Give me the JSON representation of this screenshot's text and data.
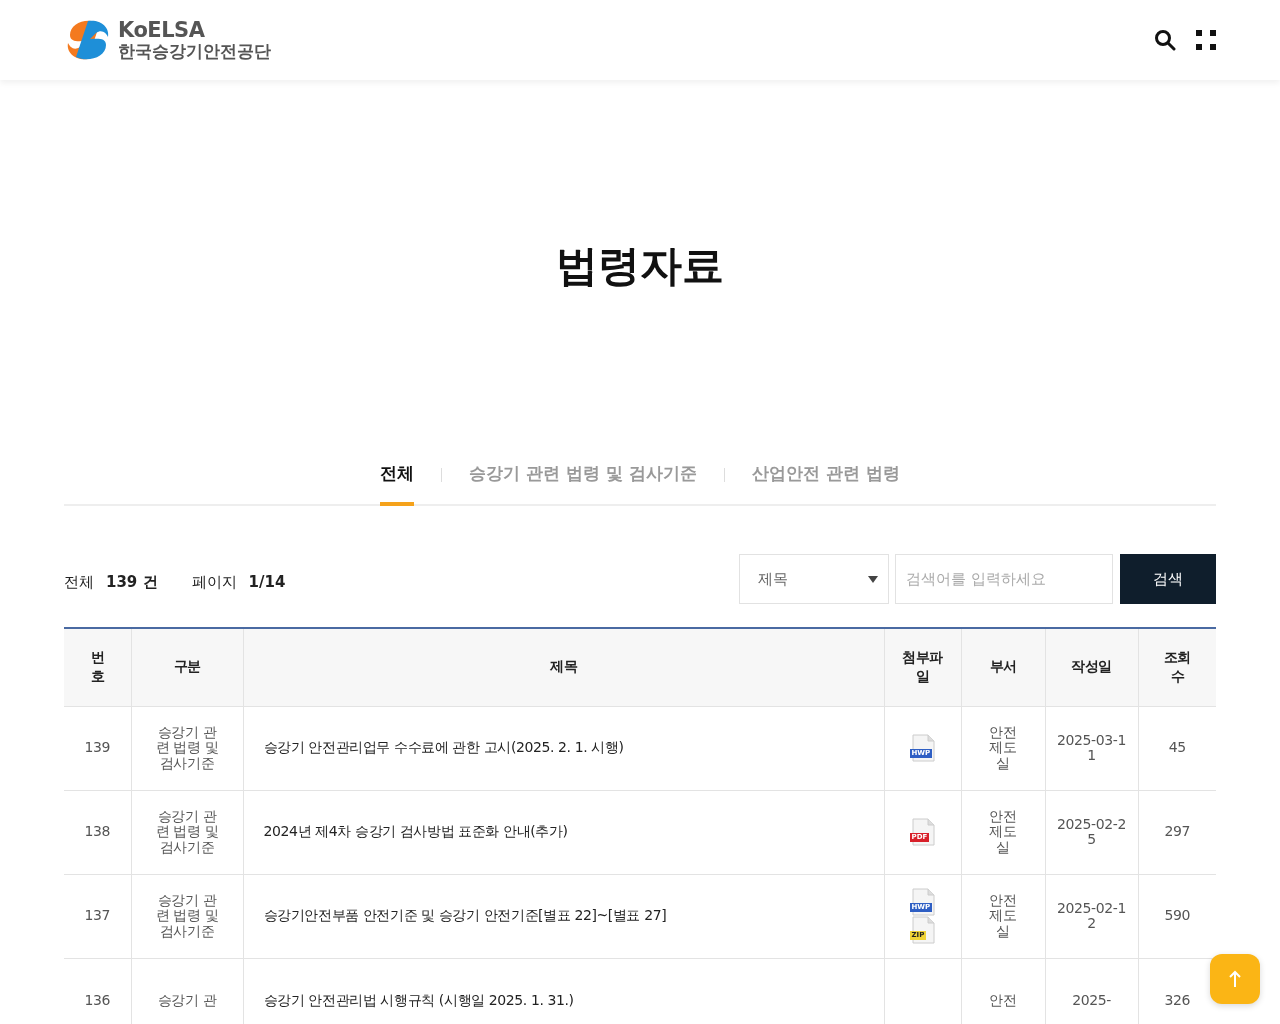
{
  "header": {
    "logo_title": "KoELSA",
    "logo_subtitle": "한국승강기안전공단"
  },
  "page_title": "법령자료",
  "tabs": [
    {
      "label": "전체",
      "selected": true
    },
    {
      "label": "승강기 관련 법령 및 검사기준",
      "selected": false
    },
    {
      "label": "산업안전 관련 법령",
      "selected": false
    }
  ],
  "summary": {
    "total_label": "전체",
    "total_value": "139 건",
    "page_label": "페이지",
    "page_value": "1/14"
  },
  "search": {
    "field": "제목",
    "placeholder": "검색어를 입력하세요",
    "button": "검색"
  },
  "table": {
    "columns": [
      "번호",
      "구분",
      "제목",
      "첨부파일",
      "부서",
      "작성일",
      "조회수"
    ],
    "rows": [
      {
        "number": "139",
        "category": "승강기 관련 법령 및 검사기준",
        "title": "승강기 안전관리업무 수수료에 관한 고시(2025. 2. 1. 시행)",
        "files": [
          {
            "kind": "hwp",
            "label": "HWP"
          }
        ],
        "department": "안전제도실",
        "date": "2025-03-11",
        "views": "45"
      },
      {
        "number": "138",
        "category": "승강기 관련 법령 및 검사기준",
        "title": "2024년 제4차 승강기 검사방법 표준화 안내(추가)",
        "files": [
          {
            "kind": "pdf",
            "label": "PDF"
          }
        ],
        "department": "안전제도실",
        "date": "2025-02-25",
        "views": "297"
      },
      {
        "number": "137",
        "category": "승강기 관련 법령 및 검사기준",
        "title": "승강기안전부품 안전기준 및 승강기 안전기준[별표 22]~[별표 27]",
        "files": [
          {
            "kind": "hwp",
            "label": "HWP"
          },
          {
            "kind": "zip",
            "label": "ZIP"
          }
        ],
        "department": "안전제도실",
        "date": "2025-02-12",
        "views": "590"
      },
      {
        "number": "136",
        "category": "승강기 관",
        "title": "승강기 안전관리법 시행규칙 (시행일 2025. 1. 31.)",
        "files": [],
        "department": "안전",
        "date": "2025-",
        "views": "326"
      }
    ]
  }
}
